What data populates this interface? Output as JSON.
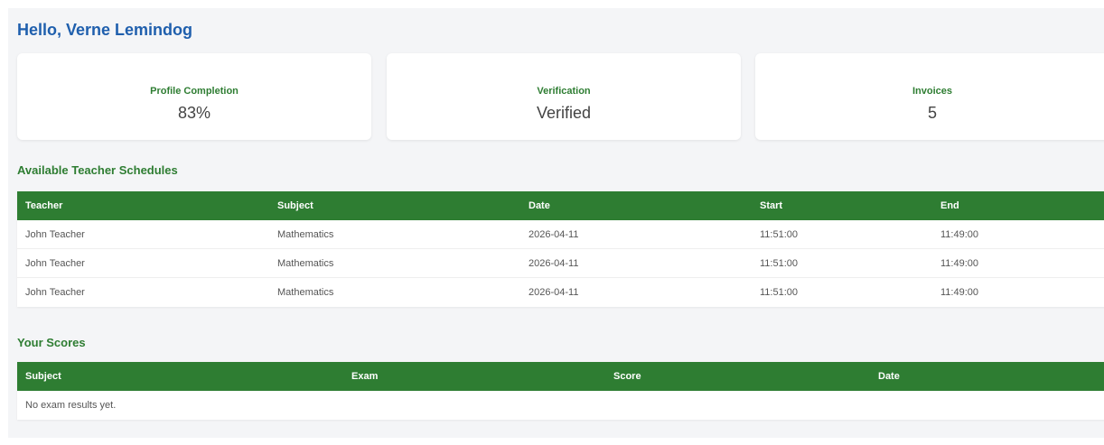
{
  "greeting": "Hello, Verne Lemindog",
  "cards": [
    {
      "title": "Profile Completion",
      "value": "83%"
    },
    {
      "title": "Verification",
      "value": "Verified"
    },
    {
      "title": "Invoices",
      "value": "5"
    }
  ],
  "schedules": {
    "title": "Available Teacher Schedules",
    "columns": [
      "Teacher",
      "Subject",
      "Date",
      "Start",
      "End"
    ],
    "rows": [
      [
        "John Teacher",
        "Mathematics",
        "2026-04-11",
        "11:51:00",
        "11:49:00"
      ],
      [
        "John Teacher",
        "Mathematics",
        "2026-04-11",
        "11:51:00",
        "11:49:00"
      ],
      [
        "John Teacher",
        "Mathematics",
        "2026-04-11",
        "11:51:00",
        "11:49:00"
      ]
    ]
  },
  "scores": {
    "title": "Your Scores",
    "columns": [
      "Subject",
      "Exam",
      "Score",
      "Date"
    ],
    "empty_message": "No exam results yet."
  }
}
